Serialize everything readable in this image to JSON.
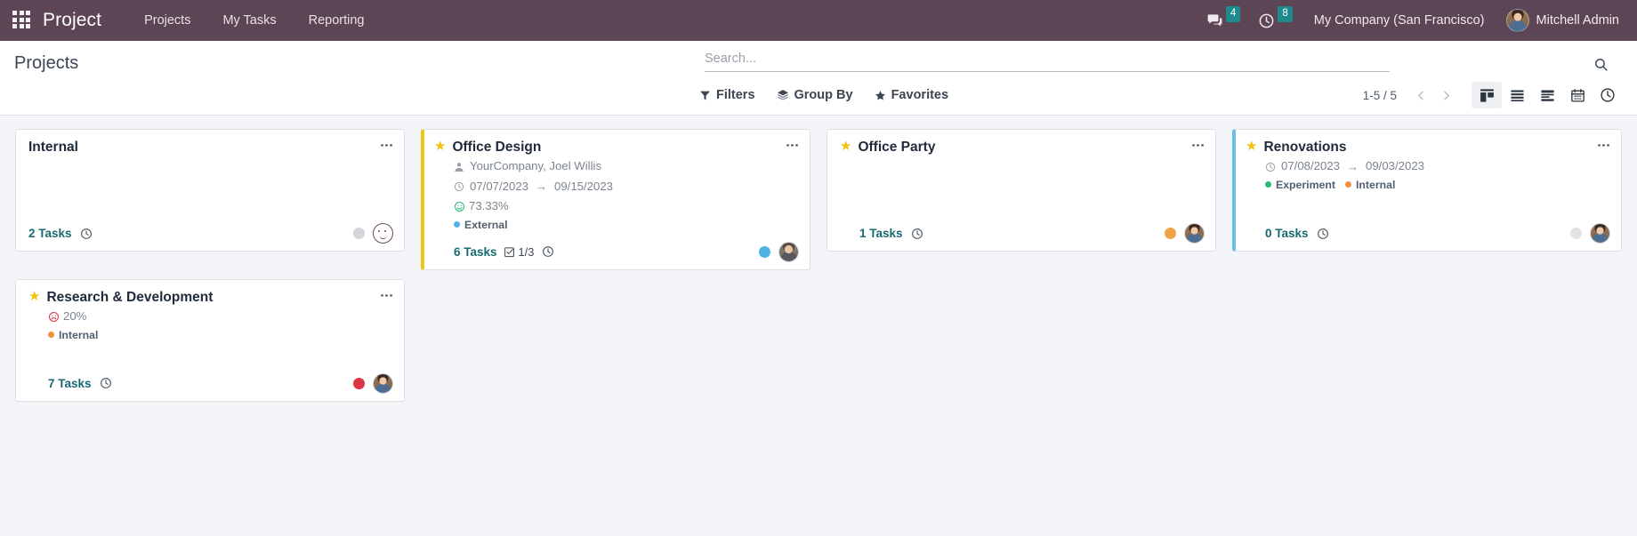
{
  "navbar": {
    "apps_icon": "apps-grid-icon",
    "brand": "Project",
    "menu": [
      {
        "label": "Projects"
      },
      {
        "label": "My Tasks"
      },
      {
        "label": "Reporting"
      }
    ],
    "messages": {
      "icon": "chat-bubble-icon",
      "count": "4"
    },
    "activities": {
      "icon": "clock-icon",
      "count": "8"
    },
    "company": "My Company (San Francisco)",
    "user": "Mitchell Admin",
    "badge_color": "#1d8a8e",
    "bg_color": "#5c4554"
  },
  "control_panel": {
    "title": "Projects",
    "search": {
      "placeholder": "Search...",
      "value": "",
      "icon": "search-icon"
    },
    "filters_label": "Filters",
    "group_by_label": "Group By",
    "favorites_label": "Favorites",
    "pager": "1-5 / 5",
    "prev_icon": "chevron-left-icon",
    "next_icon": "chevron-right-icon",
    "views": [
      {
        "name": "kanban",
        "icon": "kanban-icon",
        "active": true
      },
      {
        "name": "list",
        "icon": "list-icon",
        "active": false
      },
      {
        "name": "activity",
        "icon": "activity-icon",
        "active": false
      },
      {
        "name": "calendar",
        "icon": "calendar-icon",
        "active": false
      },
      {
        "name": "timesheet",
        "icon": "clock-icon",
        "active": false
      }
    ]
  },
  "kanban": {
    "cards": [
      {
        "title": "Internal",
        "favorite": false,
        "accent": "none",
        "partner": null,
        "date_start": null,
        "date_end": null,
        "rating": null,
        "rating_face": null,
        "tags": [],
        "tasks_count": "2 Tasks",
        "subtasks": null,
        "status_dot": "#d2d5da",
        "avatar": "smiley"
      },
      {
        "title": "Office Design",
        "favorite": true,
        "accent": "yellow",
        "partner": "YourCompany, Joel Willis",
        "date_start": "07/07/2023",
        "date_end": "09/15/2023",
        "rating": "73.33%",
        "rating_face": "happy",
        "tags": [
          {
            "label": "External",
            "color": "#4fb3e8"
          }
        ],
        "tasks_count": "6 Tasks",
        "subtasks": "1/3",
        "status_dot": "#4fb3e8",
        "avatar": "photo-a"
      },
      {
        "title": "Office Party",
        "favorite": true,
        "accent": "none",
        "partner": null,
        "date_start": null,
        "date_end": null,
        "rating": null,
        "rating_face": null,
        "tags": [],
        "tasks_count": "1 Tasks",
        "subtasks": null,
        "status_dot": "#f0a44a",
        "avatar": "photo-b"
      },
      {
        "title": "Renovations",
        "favorite": true,
        "accent": "blue",
        "partner": null,
        "date_start": "07/08/2023",
        "date_end": "09/03/2023",
        "rating": null,
        "rating_face": null,
        "tags": [
          {
            "label": "Experiment",
            "color": "#2ab87a"
          },
          {
            "label": "Internal",
            "color": "#f0913c"
          }
        ],
        "tasks_count": "0 Tasks",
        "subtasks": null,
        "status_dot": "#e1e3e7",
        "avatar": "photo-b"
      },
      {
        "title": "Research & Development",
        "favorite": true,
        "accent": "none",
        "partner": null,
        "date_start": null,
        "date_end": null,
        "rating": "20%",
        "rating_face": "sad",
        "tags": [
          {
            "label": "Internal",
            "color": "#f0913c"
          }
        ],
        "tasks_count": "7 Tasks",
        "subtasks": null,
        "status_dot": "#dc3545",
        "avatar": "photo-b"
      }
    ],
    "arrow_glyph": "→",
    "menu_glyph": "⋮"
  }
}
